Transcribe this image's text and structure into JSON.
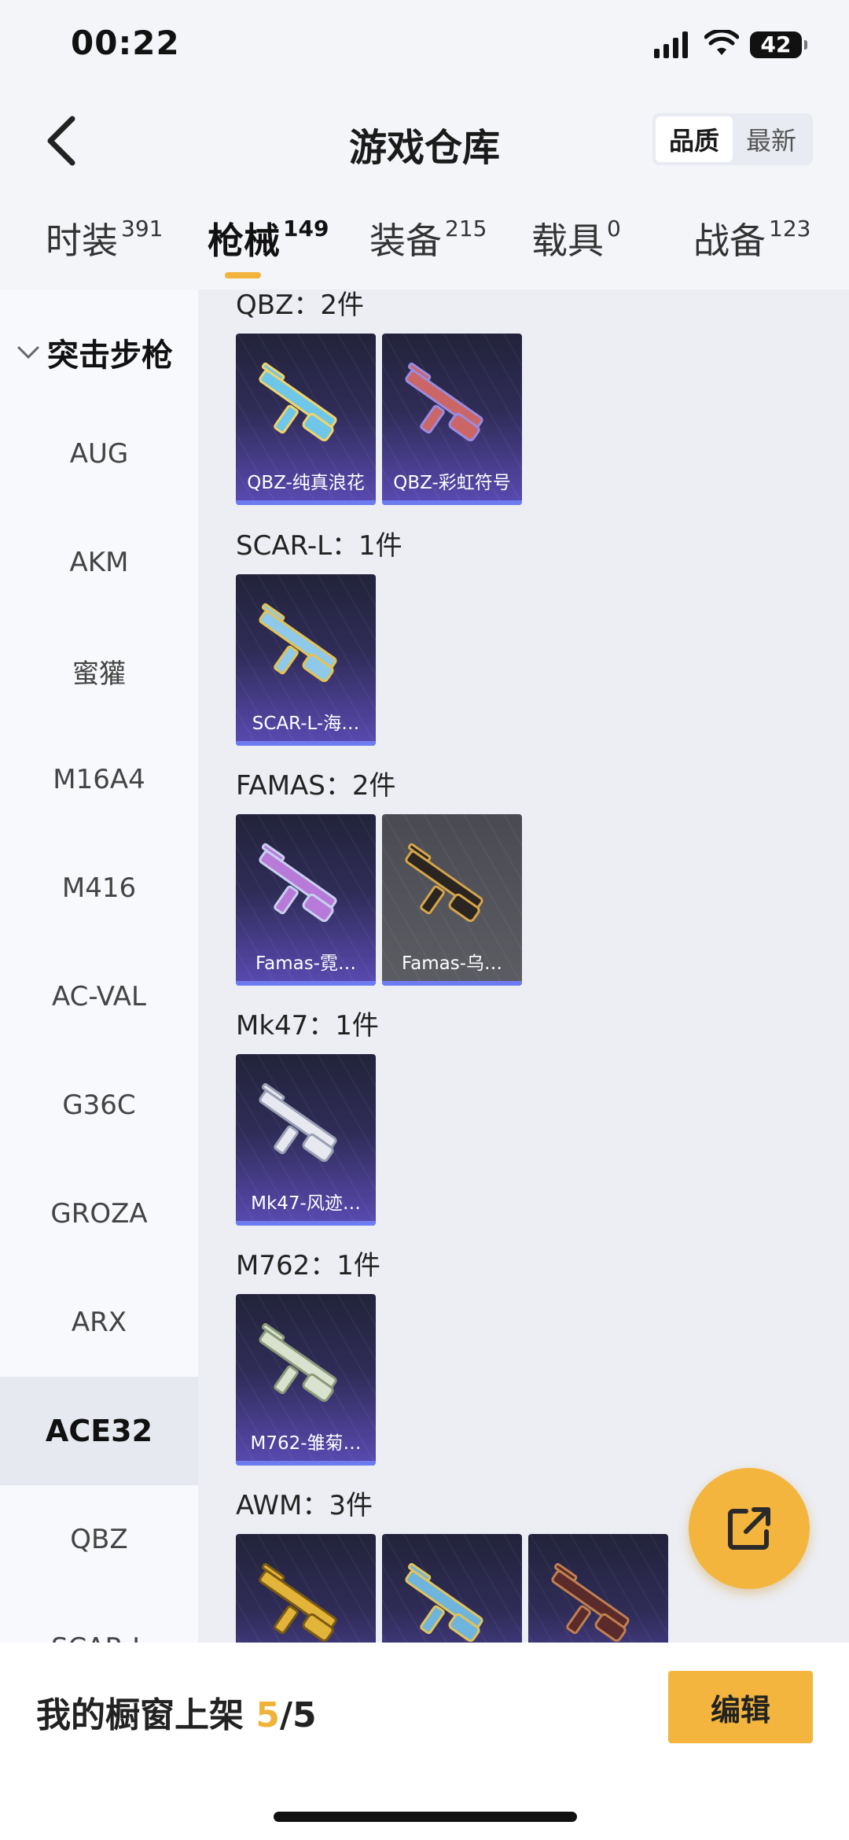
{
  "status_bar": {
    "time": "00:22",
    "battery": "42"
  },
  "header": {
    "title": "游戏仓库",
    "sort_options": [
      "品质",
      "最新"
    ],
    "sort_selected": "品质"
  },
  "tabs": [
    {
      "label": "时装",
      "count": "391"
    },
    {
      "label": "枪械",
      "count": "149",
      "active": true
    },
    {
      "label": "装备",
      "count": "215"
    },
    {
      "label": "载具",
      "count": "0"
    },
    {
      "label": "战备",
      "count": "123"
    }
  ],
  "sidebar": {
    "category": "突击步枪",
    "items": [
      "AUG",
      "AKM",
      "蜜獾",
      "M16A4",
      "M416",
      "AC-VAL",
      "G36C",
      "GROZA",
      "ARX",
      "ACE32",
      "QBZ",
      "SCAR-L"
    ],
    "selected": "ACE32"
  },
  "groups": [
    {
      "title": "QBZ：2件",
      "items": [
        {
          "name": "QBZ-纯真浪花",
          "rarity": "purple",
          "icon": "qbz-rifle-icon"
        },
        {
          "name": "QBZ-彩虹符号",
          "rarity": "purple",
          "icon": "qbz-rifle-icon"
        }
      ]
    },
    {
      "title": "SCAR-L：1件",
      "items": [
        {
          "name": "SCAR-L-海…",
          "rarity": "purple",
          "icon": "scar-rifle-icon"
        }
      ]
    },
    {
      "title": "FAMAS：2件",
      "items": [
        {
          "name": "Famas-霓…",
          "rarity": "purple",
          "icon": "famas-rifle-icon"
        },
        {
          "name": "Famas-乌…",
          "rarity": "grey",
          "icon": "famas-rifle-icon"
        }
      ]
    },
    {
      "title": "Mk47：1件",
      "items": [
        {
          "name": "Mk47-风迹…",
          "rarity": "purple",
          "icon": "mk47-rifle-icon"
        }
      ]
    },
    {
      "title": "M762：1件",
      "items": [
        {
          "name": "M762-雏菊…",
          "rarity": "purple",
          "icon": "m762-rifle-icon"
        }
      ]
    },
    {
      "title": "AWM：3件",
      "items": [
        {
          "name": "",
          "rarity": "purple",
          "icon": "awm-sniper-icon"
        },
        {
          "name": "",
          "rarity": "purple",
          "icon": "awm-sniper-icon"
        },
        {
          "name": "",
          "rarity": "purple",
          "icon": "awm-sniper-icon"
        }
      ]
    }
  ],
  "bottom_bar": {
    "label": "我的橱窗上架 ",
    "current": "5",
    "separator": "/",
    "total": "5",
    "edit_label": "编辑"
  },
  "colors": {
    "accent": "#f3b53d",
    "purple_card": "#5a4ab3",
    "grey_card": "#5c5d63"
  }
}
